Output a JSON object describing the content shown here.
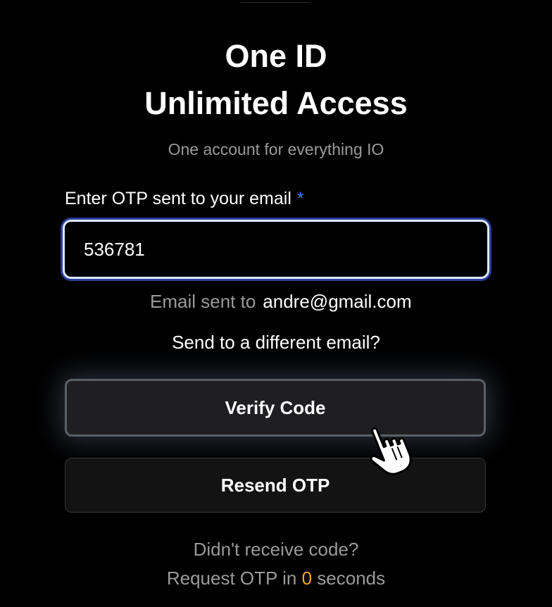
{
  "header": {
    "title_line1": "One ID",
    "title_line2": "Unlimited Access",
    "subtitle": "One account for everything IO"
  },
  "otp_field": {
    "label": "Enter OTP sent to your email",
    "required_marker": "*",
    "value": "536781"
  },
  "email_info": {
    "prefix": "Email sent to",
    "email": "andre@gmail.com",
    "change_link": "Send to a different email?"
  },
  "buttons": {
    "verify_label": "Verify Code",
    "resend_label": "Resend OTP"
  },
  "footer": {
    "line1": "Didn't receive code?",
    "line2_prefix": "Request OTP in",
    "countdown": "0",
    "line2_suffix": "seconds"
  },
  "cursor": {
    "icon": "hand-pointer-icon"
  },
  "colors": {
    "background": "#000000",
    "accent_blue": "#3b82f6",
    "countdown_orange": "#f5a623",
    "muted_text": "#9a9a9a",
    "focus_ring": "#2d3f99"
  }
}
